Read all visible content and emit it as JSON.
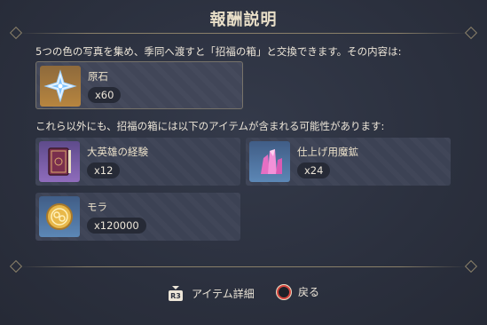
{
  "dialog": {
    "title": "報酬説明",
    "description": "5つの色の写真を集め、季同へ渡すと「招福の箱」と交換できます。その内容は:",
    "sub_description": "これら以外にも、招福の箱には以下のアイテムが含まれる可能性があります:"
  },
  "main_reward": {
    "name": "原石",
    "qty": "x60",
    "icon": "primogem-icon"
  },
  "possible_rewards": [
    {
      "name": "大英雄の経験",
      "qty": "x12",
      "icon": "heros-wit-book-icon"
    },
    {
      "name": "仕上げ用魔鉱",
      "qty": "x24",
      "icon": "mystic-ore-icon"
    },
    {
      "name": "モラ",
      "qty": "x120000",
      "icon": "mora-coin-icon"
    }
  ],
  "footer": {
    "details_key": "R3",
    "details_label": "アイテム詳細",
    "back_label": "戻る"
  },
  "colors": {
    "background": "#2c3140",
    "card": "#3c4254",
    "rarity_5": "#b7853f",
    "rarity_4": "#8f6cbc",
    "rarity_3": "#5c87b6",
    "back_button_ring": "#d7473f"
  }
}
